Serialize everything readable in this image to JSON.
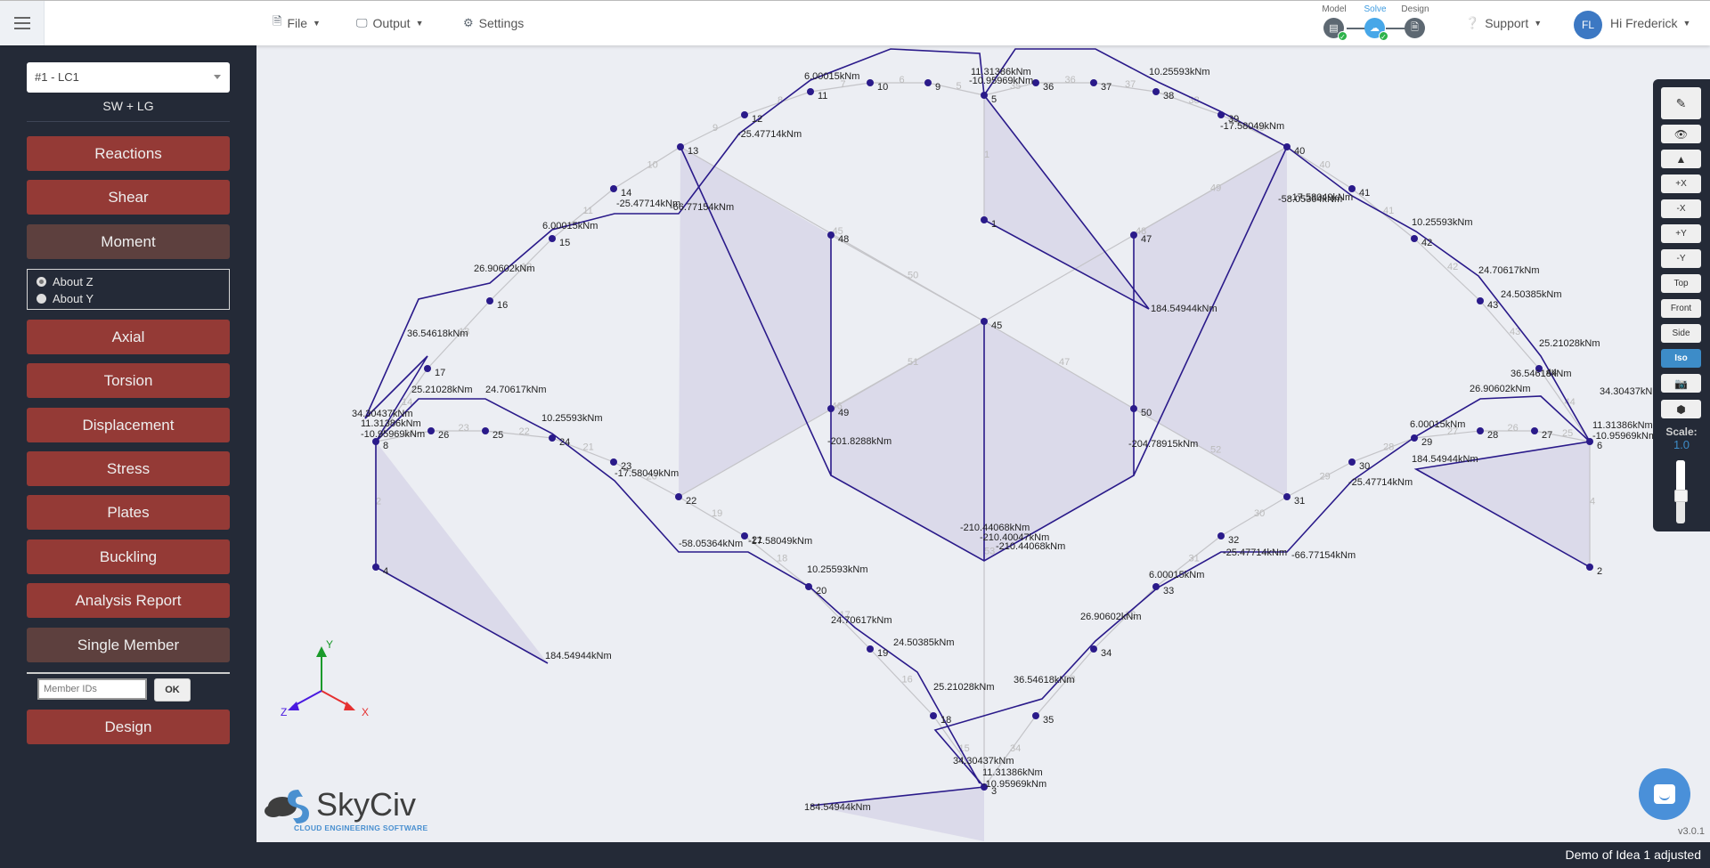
{
  "topbar": {
    "menu": [
      {
        "label": "File",
        "icon": "file-icon"
      },
      {
        "label": "Output",
        "icon": "monitor-icon"
      },
      {
        "label": "Settings",
        "icon": "gear-icon"
      }
    ],
    "steps": [
      {
        "label": "Model",
        "active": false,
        "done": true
      },
      {
        "label": "Solve",
        "active": true,
        "done": true
      },
      {
        "label": "Design",
        "active": false,
        "done": false
      }
    ],
    "support_label": "Support",
    "user_initials": "FL",
    "user_greeting": "Hi Frederick"
  },
  "sidebar": {
    "load_case": "#1 - LC1",
    "load_case_desc": "SW + LG",
    "buttons": {
      "reactions": "Reactions",
      "shear": "Shear",
      "moment": "Moment",
      "axial": "Axial",
      "torsion": "Torsion",
      "displacement": "Displacement",
      "stress": "Stress",
      "plates": "Plates",
      "buckling": "Buckling",
      "analysis_report": "Analysis Report",
      "single_member": "Single Member",
      "design": "Design"
    },
    "moment_axis": {
      "options": [
        "About Z",
        "About Y"
      ],
      "selected": "About Z"
    },
    "member_ids_placeholder": "Member IDs",
    "ok_label": "OK"
  },
  "toolbar": {
    "buttons": [
      "pencil-icon",
      "eye-icon",
      "area-chart-icon",
      "+X",
      "-X",
      "+Y",
      "-Y",
      "Top",
      "Front",
      "Side",
      "Iso",
      "camera-icon",
      "cube-icon"
    ],
    "active": "Iso",
    "scale_label": "Scale:",
    "scale_value": "1.0"
  },
  "model": {
    "nodes": [
      {
        "id": "1"
      },
      {
        "id": "2"
      },
      {
        "id": "3"
      },
      {
        "id": "4"
      },
      {
        "id": "5"
      },
      {
        "id": "6"
      },
      {
        "id": "8"
      },
      {
        "id": "9"
      },
      {
        "id": "10"
      },
      {
        "id": "11"
      },
      {
        "id": "12"
      },
      {
        "id": "13"
      },
      {
        "id": "14"
      },
      {
        "id": "15"
      },
      {
        "id": "16"
      },
      {
        "id": "17"
      },
      {
        "id": "18"
      },
      {
        "id": "19"
      },
      {
        "id": "20"
      },
      {
        "id": "21"
      },
      {
        "id": "22"
      },
      {
        "id": "23"
      },
      {
        "id": "24"
      },
      {
        "id": "25"
      },
      {
        "id": "26"
      },
      {
        "id": "27"
      },
      {
        "id": "28"
      },
      {
        "id": "29"
      },
      {
        "id": "30"
      },
      {
        "id": "31"
      },
      {
        "id": "32"
      },
      {
        "id": "33"
      },
      {
        "id": "34"
      },
      {
        "id": "35"
      },
      {
        "id": "36"
      },
      {
        "id": "37"
      },
      {
        "id": "38"
      },
      {
        "id": "39"
      },
      {
        "id": "40"
      },
      {
        "id": "41"
      },
      {
        "id": "42"
      },
      {
        "id": "43"
      },
      {
        "id": "44"
      },
      {
        "id": "45"
      },
      {
        "id": "47"
      },
      {
        "id": "48"
      },
      {
        "id": "49"
      },
      {
        "id": "50"
      }
    ],
    "moment_labels": [
      "6.00015kNm",
      "11.31386kNm",
      "-10.95969kNm",
      "10.25593kNm",
      "-17.58049kNm",
      "-25.47714kNm",
      "-66.77154kNm",
      "-58.05364kNm",
      "26.90602kNm",
      "36.54618kNm",
      "34.30437kNm",
      "25.21028kNm",
      "24.70617kNm",
      "24.50385kNm",
      "184.54944kNm",
      "-201.8288kNm",
      "-204.78915kNm",
      "-210.44068kNm",
      "-210.40047kNm"
    ],
    "axes": {
      "x": "X",
      "y": "Y",
      "z": "Z"
    }
  },
  "branding": {
    "logo_name": "SkyCiv",
    "logo_tagline": "CLOUD ENGINEERING SOFTWARE"
  },
  "version": "v3.0.1",
  "footer_text": "Demo of Idea 1 adjusted",
  "colors": {
    "sidebar_bg": "#242a37",
    "button_red": "#943a36",
    "button_active": "#5d403e",
    "accent_blue": "#3d8cc8",
    "diagram_line": "#2a1a8a",
    "diagram_fill": "#d8d6e8"
  }
}
